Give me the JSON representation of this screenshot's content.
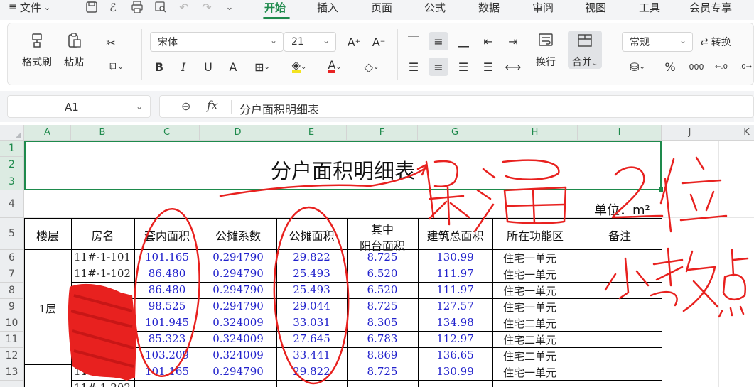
{
  "menu": {
    "file_label": "文件",
    "tabs": [
      "开始",
      "插入",
      "页面",
      "公式",
      "数据",
      "审阅",
      "视图",
      "工具",
      "会员专享"
    ],
    "active_tab": "开始",
    "accent_color": "#1e8a4c"
  },
  "ribbon": {
    "format_painter": "格式刷",
    "paste": "粘贴",
    "font_name": "宋体",
    "font_size": "21",
    "wrap": "换行",
    "merge": "合并",
    "number_format": "常规",
    "convert": "转换"
  },
  "formula_bar": {
    "cell_ref": "A1",
    "fx_label": "fx",
    "content": "分户面积明细表"
  },
  "sheet": {
    "columns": [
      "A",
      "B",
      "C",
      "D",
      "E",
      "F",
      "G",
      "H",
      "I",
      "J",
      "K"
    ],
    "rows": [
      "1",
      "2",
      "3",
      "4",
      "5",
      "6",
      "7",
      "8",
      "9",
      "10",
      "11",
      "12",
      "13"
    ],
    "title": "分户面积明细表",
    "unit": "单位：m²",
    "headers": {
      "floor": "楼层",
      "room": "房名",
      "inner_area": "套内面积",
      "share_coef": "公摊系数",
      "share_area": "公摊面积",
      "balcony_1": "其中",
      "balcony_2": "阳台面积",
      "total_area": "建筑总面积",
      "zone": "所在功能区",
      "remark": "备注"
    },
    "floor_label": "1层",
    "data_rows": [
      {
        "room": "11#-1-101",
        "inner": "101.165",
        "coef": "0.294790",
        "share": "29.822",
        "balcony": "8.725",
        "total": "130.99",
        "zone": "住宅一单元"
      },
      {
        "room": "11#-1-102",
        "inner": "86.480",
        "coef": "0.294790",
        "share": "25.493",
        "balcony": "6.520",
        "total": "111.97",
        "zone": "住宅一单元"
      },
      {
        "room": "",
        "inner": "86.480",
        "coef": "0.294790",
        "share": "25.493",
        "balcony": "6.520",
        "total": "111.97",
        "zone": "住宅一单元"
      },
      {
        "room": "",
        "inner": "98.525",
        "coef": "0.294790",
        "share": "29.044",
        "balcony": "8.725",
        "total": "127.57",
        "zone": "住宅一单元"
      },
      {
        "room": "",
        "inner": "101.945",
        "coef": "0.324009",
        "share": "33.031",
        "balcony": "8.305",
        "total": "134.98",
        "zone": "住宅二单元"
      },
      {
        "room": "",
        "inner": "85.323",
        "coef": "0.324009",
        "share": "27.645",
        "balcony": "6.783",
        "total": "112.97",
        "zone": "住宅二单元"
      },
      {
        "room": "11#",
        "inner": "103.209",
        "coef": "0.324009",
        "share": "33.441",
        "balcony": "8.869",
        "total": "136.65",
        "zone": "住宅二单元"
      },
      {
        "room": "11#",
        "inner": "101.165",
        "coef": "0.294790",
        "share": "29.822",
        "balcony": "8.725",
        "total": "130.99",
        "zone": "住宅一单元"
      }
    ],
    "partial_row_room": "11#-1-202"
  },
  "annotation": {
    "handwriting_line1": "保留2位",
    "handwriting_line2": "小数点",
    "ink_color": "#e8211f"
  }
}
